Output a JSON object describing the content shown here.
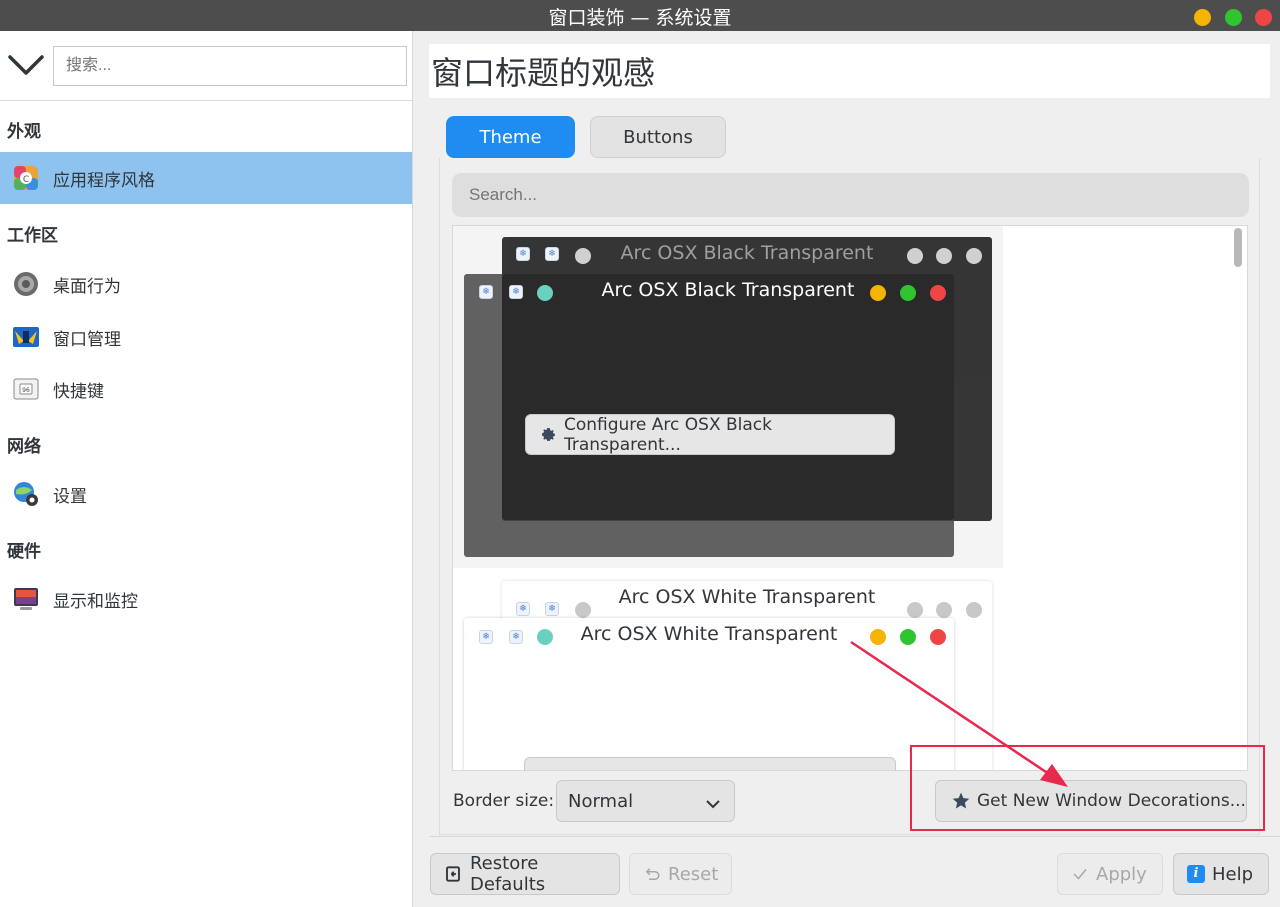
{
  "window": {
    "title": "窗口装饰 — 系统设置",
    "controls": {
      "minimize": "#f5b400",
      "maximize": "#2ec52e",
      "close": "#f04545"
    }
  },
  "sidebar": {
    "search_placeholder": "搜索...",
    "categories": [
      {
        "label": "外观"
      },
      {
        "label": "工作区"
      },
      {
        "label": "网络"
      },
      {
        "label": "硬件"
      }
    ],
    "items": [
      {
        "label": "应用程序风格",
        "icon": "app-style-icon",
        "active": true
      },
      {
        "label": "桌面行为",
        "icon": "desktop-behavior-icon"
      },
      {
        "label": "窗口管理",
        "icon": "window-management-icon"
      },
      {
        "label": "快捷键",
        "icon": "shortcuts-icon"
      },
      {
        "label": "设置",
        "icon": "network-settings-icon"
      },
      {
        "label": "显示和监控",
        "icon": "display-monitor-icon"
      }
    ]
  },
  "main": {
    "heading": "窗口标题的观感",
    "tabs": [
      {
        "label": "Theme",
        "active": true
      },
      {
        "label": "Buttons",
        "active": false
      }
    ],
    "search_placeholder": "Search...",
    "themes": [
      {
        "name": "Arc OSX Black Transparent",
        "back_title": "Arc OSX Black Transparent",
        "configure_label": "Configure Arc OSX Black Transparent...",
        "selected": true
      },
      {
        "name": "Arc OSX White Transparent",
        "back_title": "Arc OSX White Transparent",
        "configure_label": "",
        "selected": false
      }
    ],
    "border_size_label": "Border size:",
    "border_size_value": "Normal",
    "get_new_label": "Get New Window Decorations...",
    "accent_color": "#1e8cf0",
    "highlight_color": "#e8294d"
  },
  "footer": {
    "restore_defaults": "Restore Defaults",
    "reset": "Reset",
    "apply": "Apply",
    "help": "Help"
  }
}
